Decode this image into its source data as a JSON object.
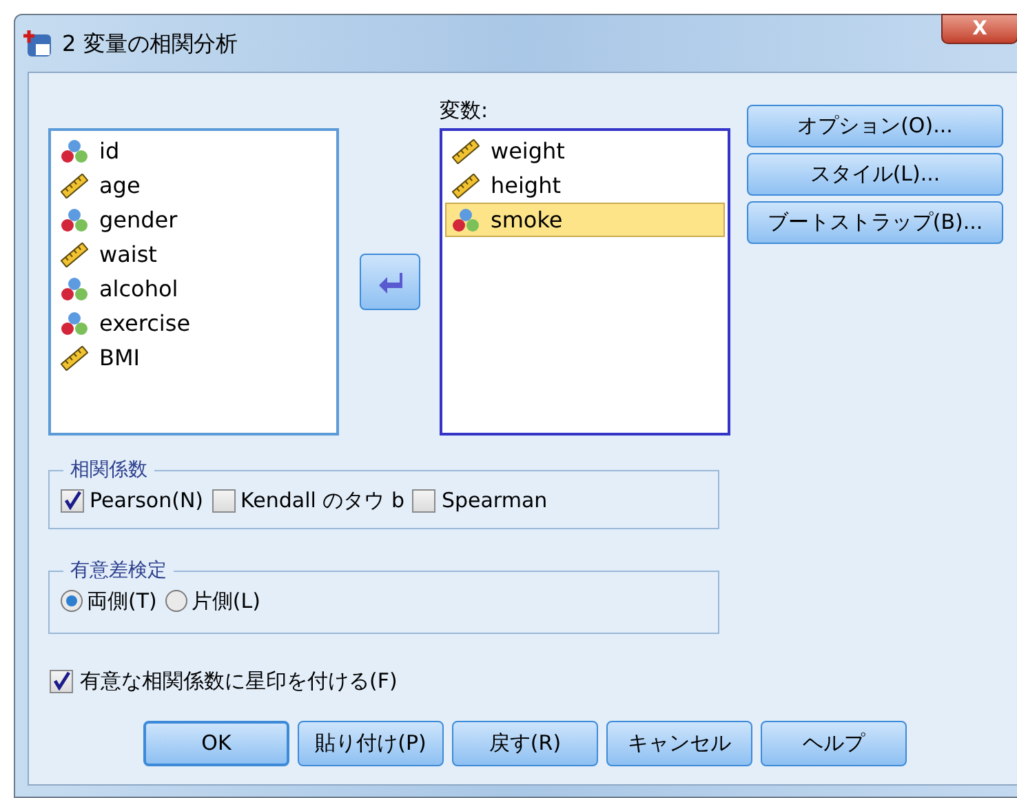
{
  "window": {
    "title": "2 変量の相関分析",
    "close": "X"
  },
  "source_list": {
    "items": [
      {
        "name": "id",
        "kind": "nominal",
        "selected": false
      },
      {
        "name": "age",
        "kind": "scale",
        "selected": false
      },
      {
        "name": "gender",
        "kind": "nominal",
        "selected": false
      },
      {
        "name": "waist",
        "kind": "scale",
        "selected": false
      },
      {
        "name": "alcohol",
        "kind": "nominal",
        "selected": false
      },
      {
        "name": "exercise",
        "kind": "nominal",
        "selected": false
      },
      {
        "name": "BMI",
        "kind": "scale",
        "selected": false
      }
    ]
  },
  "variables": {
    "label": "変数:",
    "items": [
      {
        "name": "weight",
        "kind": "scale",
        "selected": false
      },
      {
        "name": "height",
        "kind": "scale",
        "selected": false
      },
      {
        "name": "smoke",
        "kind": "nominal",
        "selected": true
      }
    ]
  },
  "side_buttons": [
    "オプション(O)...",
    "スタイル(L)...",
    "ブートストラップ(B)..."
  ],
  "correlation": {
    "title": "相関係数",
    "options": [
      {
        "label": "Pearson(N)",
        "checked": true
      },
      {
        "label": "Kendall のタウ b",
        "checked": false
      },
      {
        "label": "Spearman",
        "checked": false
      }
    ]
  },
  "significance": {
    "title": "有意差検定",
    "options": [
      {
        "label": "両側(T)",
        "selected": true
      },
      {
        "label": "片側(L)",
        "selected": false
      }
    ]
  },
  "flag": {
    "label": "有意な相関係数に星印を付ける(F)",
    "checked": true
  },
  "buttons": [
    {
      "label": "OK",
      "default": true
    },
    {
      "label": "貼り付け(P)",
      "default": false
    },
    {
      "label": "戻す(R)",
      "default": false
    },
    {
      "label": "キャンセル",
      "default": false
    },
    {
      "label": "ヘルプ",
      "default": false
    }
  ]
}
